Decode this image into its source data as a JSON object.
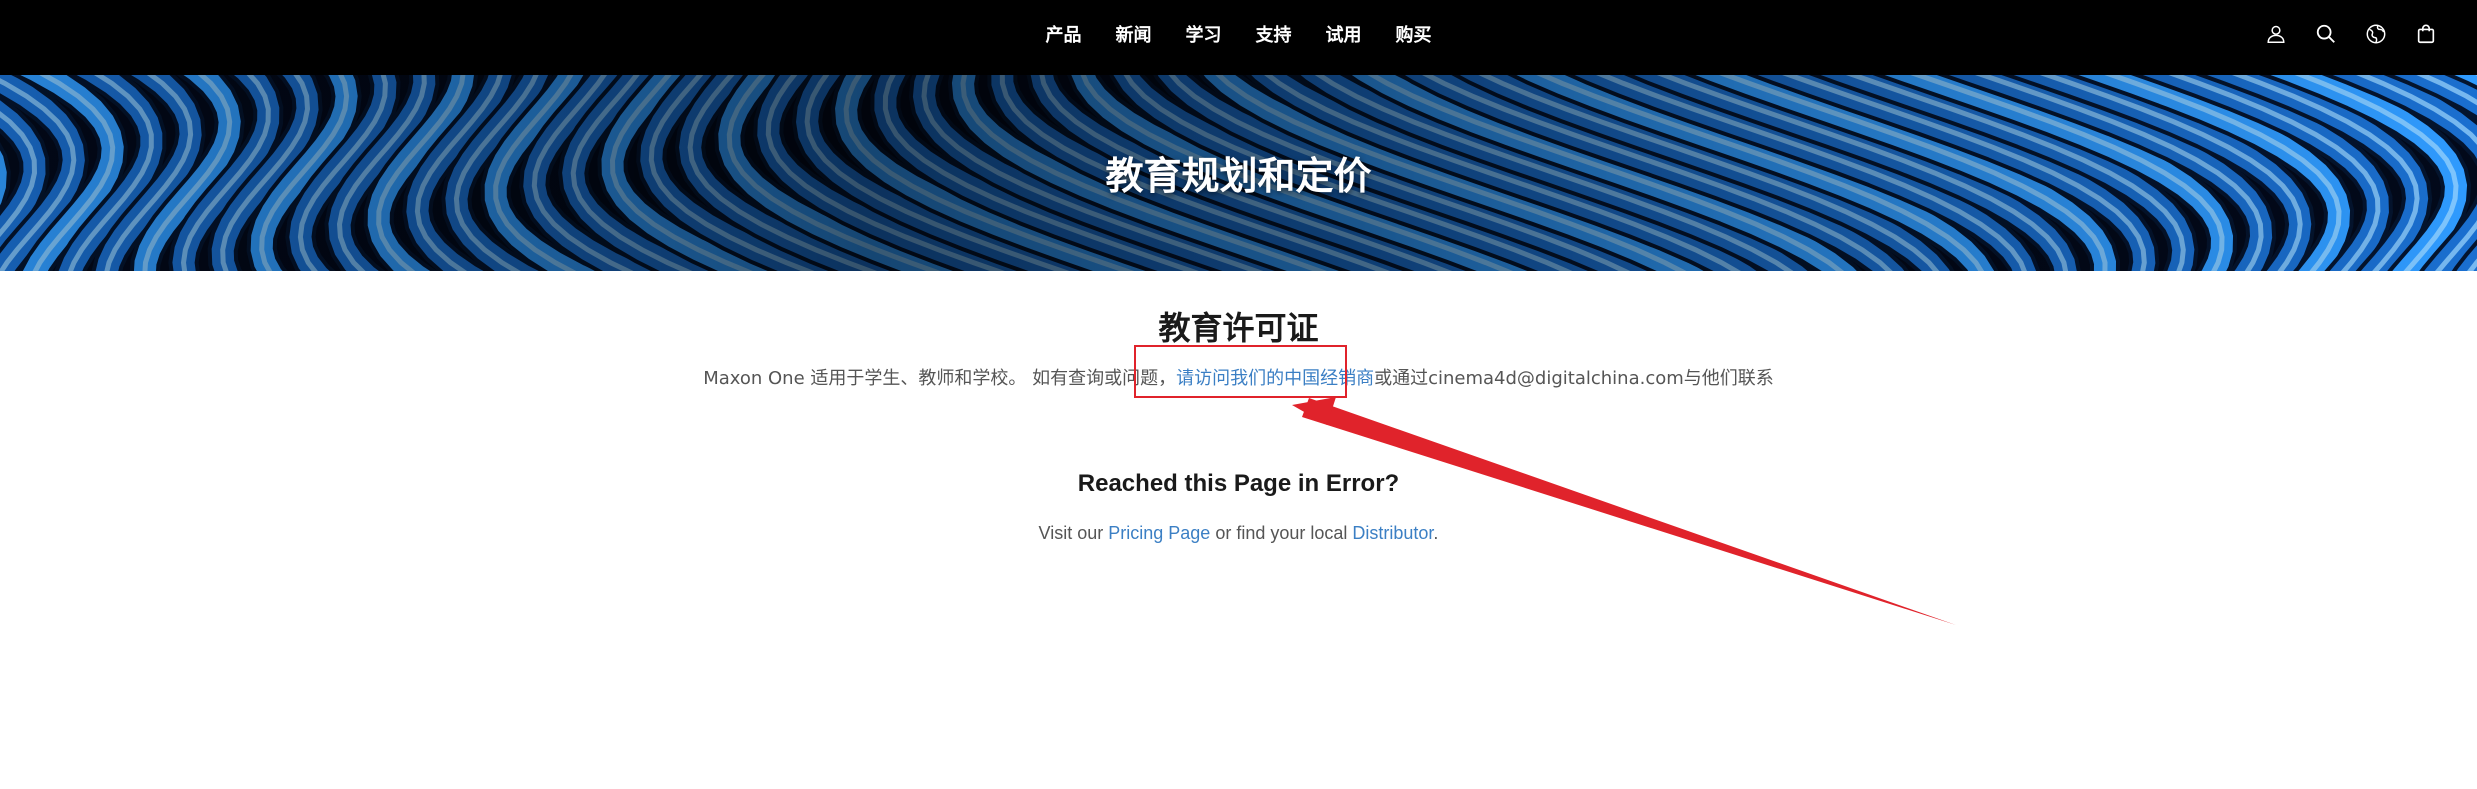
{
  "nav": {
    "items": [
      {
        "label": "产品"
      },
      {
        "label": "新闻"
      },
      {
        "label": "学习"
      },
      {
        "label": "支持"
      },
      {
        "label": "试用"
      },
      {
        "label": "购买"
      }
    ],
    "icons": [
      "user-icon",
      "search-icon",
      "globe-icon",
      "cart-icon"
    ]
  },
  "hero": {
    "title": "教育规划和定价"
  },
  "education": {
    "title": "教育许可证",
    "desc_prefix": "Maxon One 适用于学生、教师和学校。 如有查询或问题，",
    "desc_link": "请访问我们的中国经销商",
    "desc_suffix": "或通过cinema4d@digitalchina.com与他们联系"
  },
  "error": {
    "title": "Reached this Page in Error?",
    "text_1": "Visit our ",
    "link_pricing": "Pricing Page",
    "text_2": " or find your local ",
    "link_distributor": "Distributor",
    "text_3": "."
  },
  "colors": {
    "nav_bg": "#000000",
    "link": "#3b7fc4",
    "annotation": "#e0232b"
  }
}
